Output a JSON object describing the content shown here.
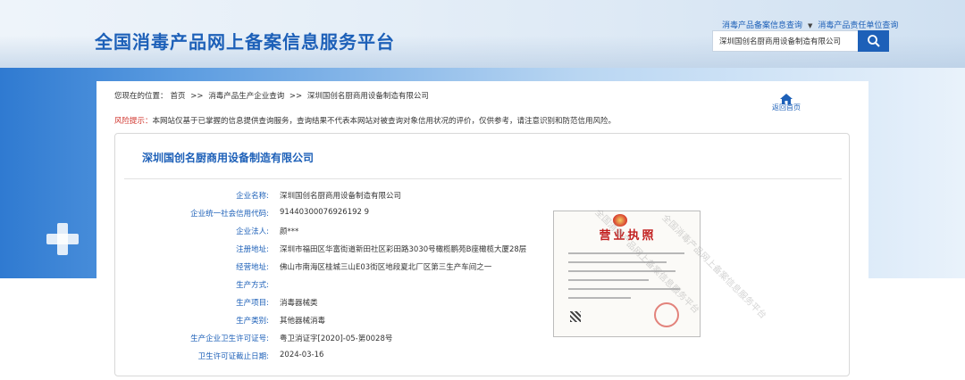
{
  "header": {
    "site_title": "全国消毒产品网上备案信息服务平台",
    "links": [
      "消毒产品备案信息查询",
      "消毒产品责任单位查询"
    ],
    "search_value": "深圳国创名厨商用设备制造有限公司"
  },
  "breadcrumb": {
    "prefix": "您现在的位置：",
    "items": [
      "首页",
      ">>",
      "消毒产品生产企业查询",
      ">>",
      "深圳国创名厨商用设备制造有限公司"
    ]
  },
  "home_link": "返回首页",
  "notice": {
    "head": "风险提示：",
    "text": "本网站仅基于已掌握的信息提供查询服务，查询结果不代表本网站对被查询对象信用状况的评价，仅供参考，请注意识别和防范信用风险。"
  },
  "company": {
    "title": "深圳国创名厨商用设备制造有限公司",
    "fields": [
      {
        "label": "企业名称:",
        "value": "深圳国创名厨商用设备制造有限公司"
      },
      {
        "label": "企业统一社会信用代码:",
        "value": "91440300076926192 9"
      },
      {
        "label": "企业法人:",
        "value": "颜***"
      },
      {
        "label": "注册地址:",
        "value": "深圳市福田区华富街道新田社区彩田路3030号橄榄鹏苑B座橄榄大厦28层"
      },
      {
        "label": "经营地址:",
        "value": "佛山市南海区桂城三山E03街区地段夏北厂区第三生产车间之一"
      },
      {
        "label": "生产方式:",
        "value": ""
      },
      {
        "label": "生产项目:",
        "value": "消毒器械类"
      },
      {
        "label": "生产类别:",
        "value": "其他器械消毒"
      },
      {
        "label": "生产企业卫生许可证号:",
        "value": "粤卫消证字[2020]-05-第0028号"
      },
      {
        "label": "卫生许可证截止日期:",
        "value": "2024-03-16"
      }
    ]
  },
  "license": {
    "title": "营业执照",
    "watermark": "全国消毒产品网上备案信息服务平台"
  },
  "colors": {
    "brand": "#1d60b8",
    "warning": "#d0342c"
  }
}
